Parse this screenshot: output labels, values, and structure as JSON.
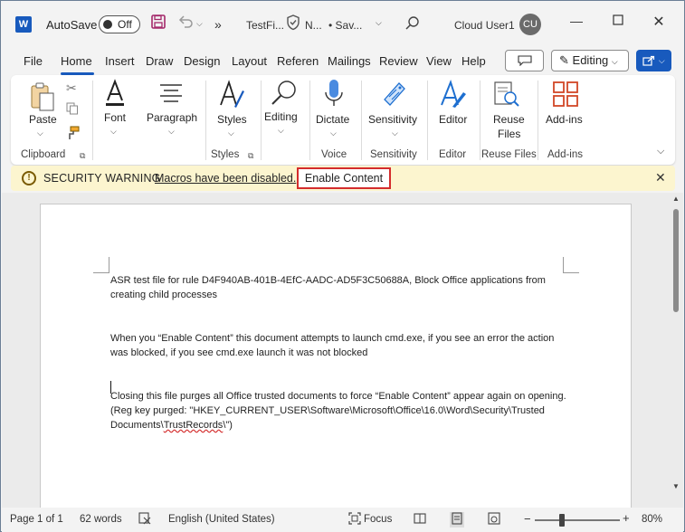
{
  "titlebar": {
    "app_logo": "W",
    "autosave_label": "AutoSave",
    "autosave_state": "Off",
    "save_icon": "save-icon",
    "undo_icon": "undo-icon",
    "more_icon": "»",
    "filename": "TestFi...",
    "sensitivity_label": "N...",
    "save_status": "• Sav...",
    "user_name": "Cloud User1",
    "user_initials": "CU"
  },
  "tabs": [
    "File",
    "Home",
    "Insert",
    "Draw",
    "Design",
    "Layout",
    "Referen",
    "Mailings",
    "Review",
    "View",
    "Help"
  ],
  "active_tab": "Home",
  "toolbar": {
    "comment_icon": "comment-icon",
    "editing_label": "Editing",
    "share_icon": "share-icon"
  },
  "ribbon": {
    "paste": "Paste",
    "font": "Font",
    "paragraph": "Paragraph",
    "styles": "Styles",
    "editing": "Editing",
    "dictate": "Dictate",
    "sensitivity": "Sensitivity",
    "editor": "Editor",
    "reuse_files_line1": "Reuse",
    "reuse_files_line2": "Files",
    "addins": "Add-ins",
    "groups": {
      "clipboard": "Clipboard",
      "styles": "Styles",
      "voice": "Voice",
      "sensitivity": "Sensitivity",
      "editor": "Editor",
      "reuse_files": "Reuse Files",
      "addins": "Add-ins"
    }
  },
  "security_bar": {
    "title": "SECURITY WARNING",
    "message": "Macros have been disabled.",
    "button": "Enable Content"
  },
  "document": {
    "p1": "ASR test file for rule D4F940AB-401B-4EfC-AADC-AD5F3C50688A, Block Office applications from creating child processes",
    "p2": "When you “Enable Content” this document attempts to launch cmd.exe, if you see an error the action was blocked, if you see cmd.exe launch it was not blocked",
    "p3_a": "Closing this file purges all Office trusted documents to force “Enable Content” appear again on opening. (Reg key purged: \"HKEY_CURRENT_USER\\Software\\Microsoft\\Office\\16.0\\Word\\Security\\Trusted Documents\\",
    "p3_squiggle": "TrustRecords",
    "p3_b": "\\\")"
  },
  "statusbar": {
    "page": "Page 1 of 1",
    "words": "62 words",
    "language": "English (United States)",
    "focus": "Focus",
    "zoom": "80%",
    "zoom_level_percent": 80
  },
  "colors": {
    "brand": "#185abd",
    "warning_bg": "#fcf5cf",
    "highlight_border": "#d42c2c"
  }
}
